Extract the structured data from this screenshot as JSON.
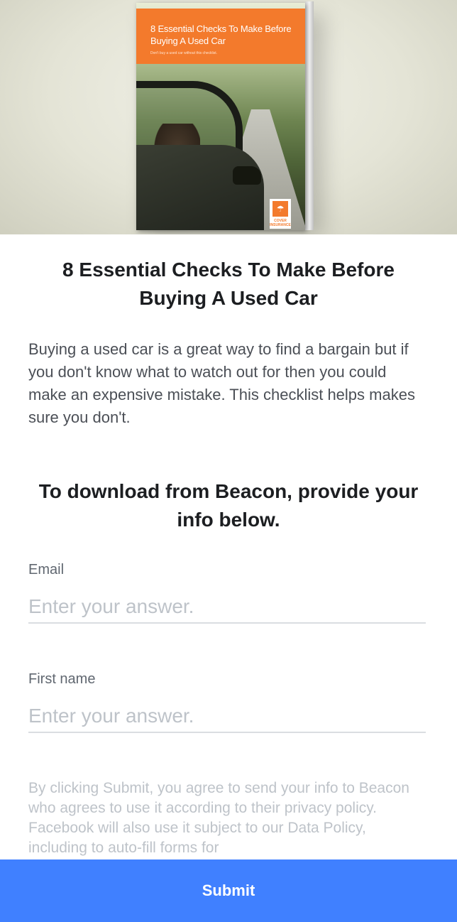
{
  "hero": {
    "book_title": "8 Essential Checks To Make Before Buying A Used Car",
    "book_subtitle": "Don't buy a used car without this checklist.",
    "brand_text": "COVER INSURANCE",
    "accent_color": "#f37a2c"
  },
  "main": {
    "title": "8 Essential Checks To Make Before Buying A Used Car",
    "description": "Buying a used car is a great way to find a bargain but if you don't know what to watch out for then you could make an expensive mistake. This checklist helps makes sure you don't.",
    "cta": "To download from Beacon, provide your info below."
  },
  "form": {
    "email": {
      "label": "Email",
      "placeholder": "Enter your answer.",
      "value": ""
    },
    "first_name": {
      "label": "First name",
      "placeholder": "Enter your answer.",
      "value": ""
    },
    "disclaimer": "By clicking Submit, you agree to send your info to Beacon who agrees to use it according to their privacy policy. Facebook will also use it subject to our Data Policy, including to auto-fill forms for"
  },
  "footer": {
    "submit_label": "Submit",
    "button_color": "#4080ff"
  }
}
